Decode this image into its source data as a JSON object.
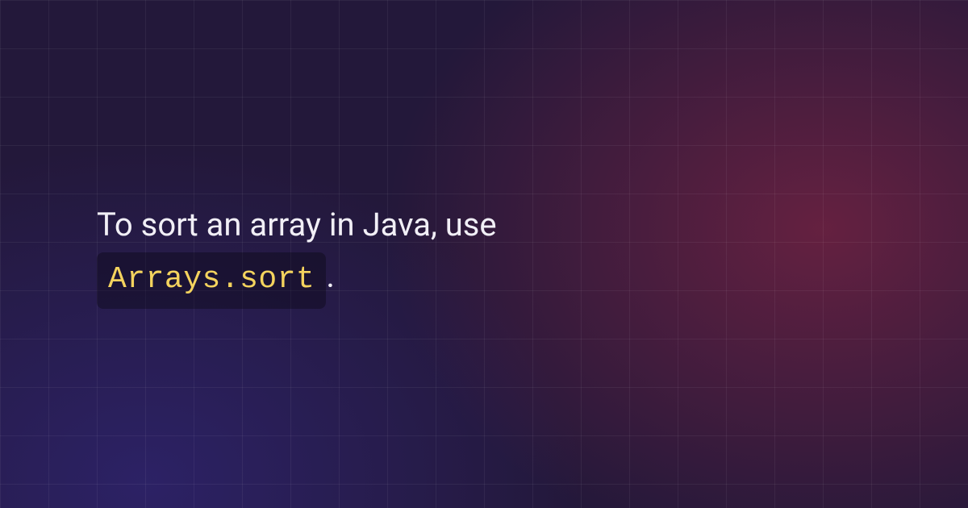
{
  "main": {
    "text_before": "To sort an array in Java, use",
    "code": "Arrays.sort",
    "text_after": "."
  },
  "colors": {
    "code_text": "#f4d35e",
    "body_text": "#f1eff6"
  }
}
